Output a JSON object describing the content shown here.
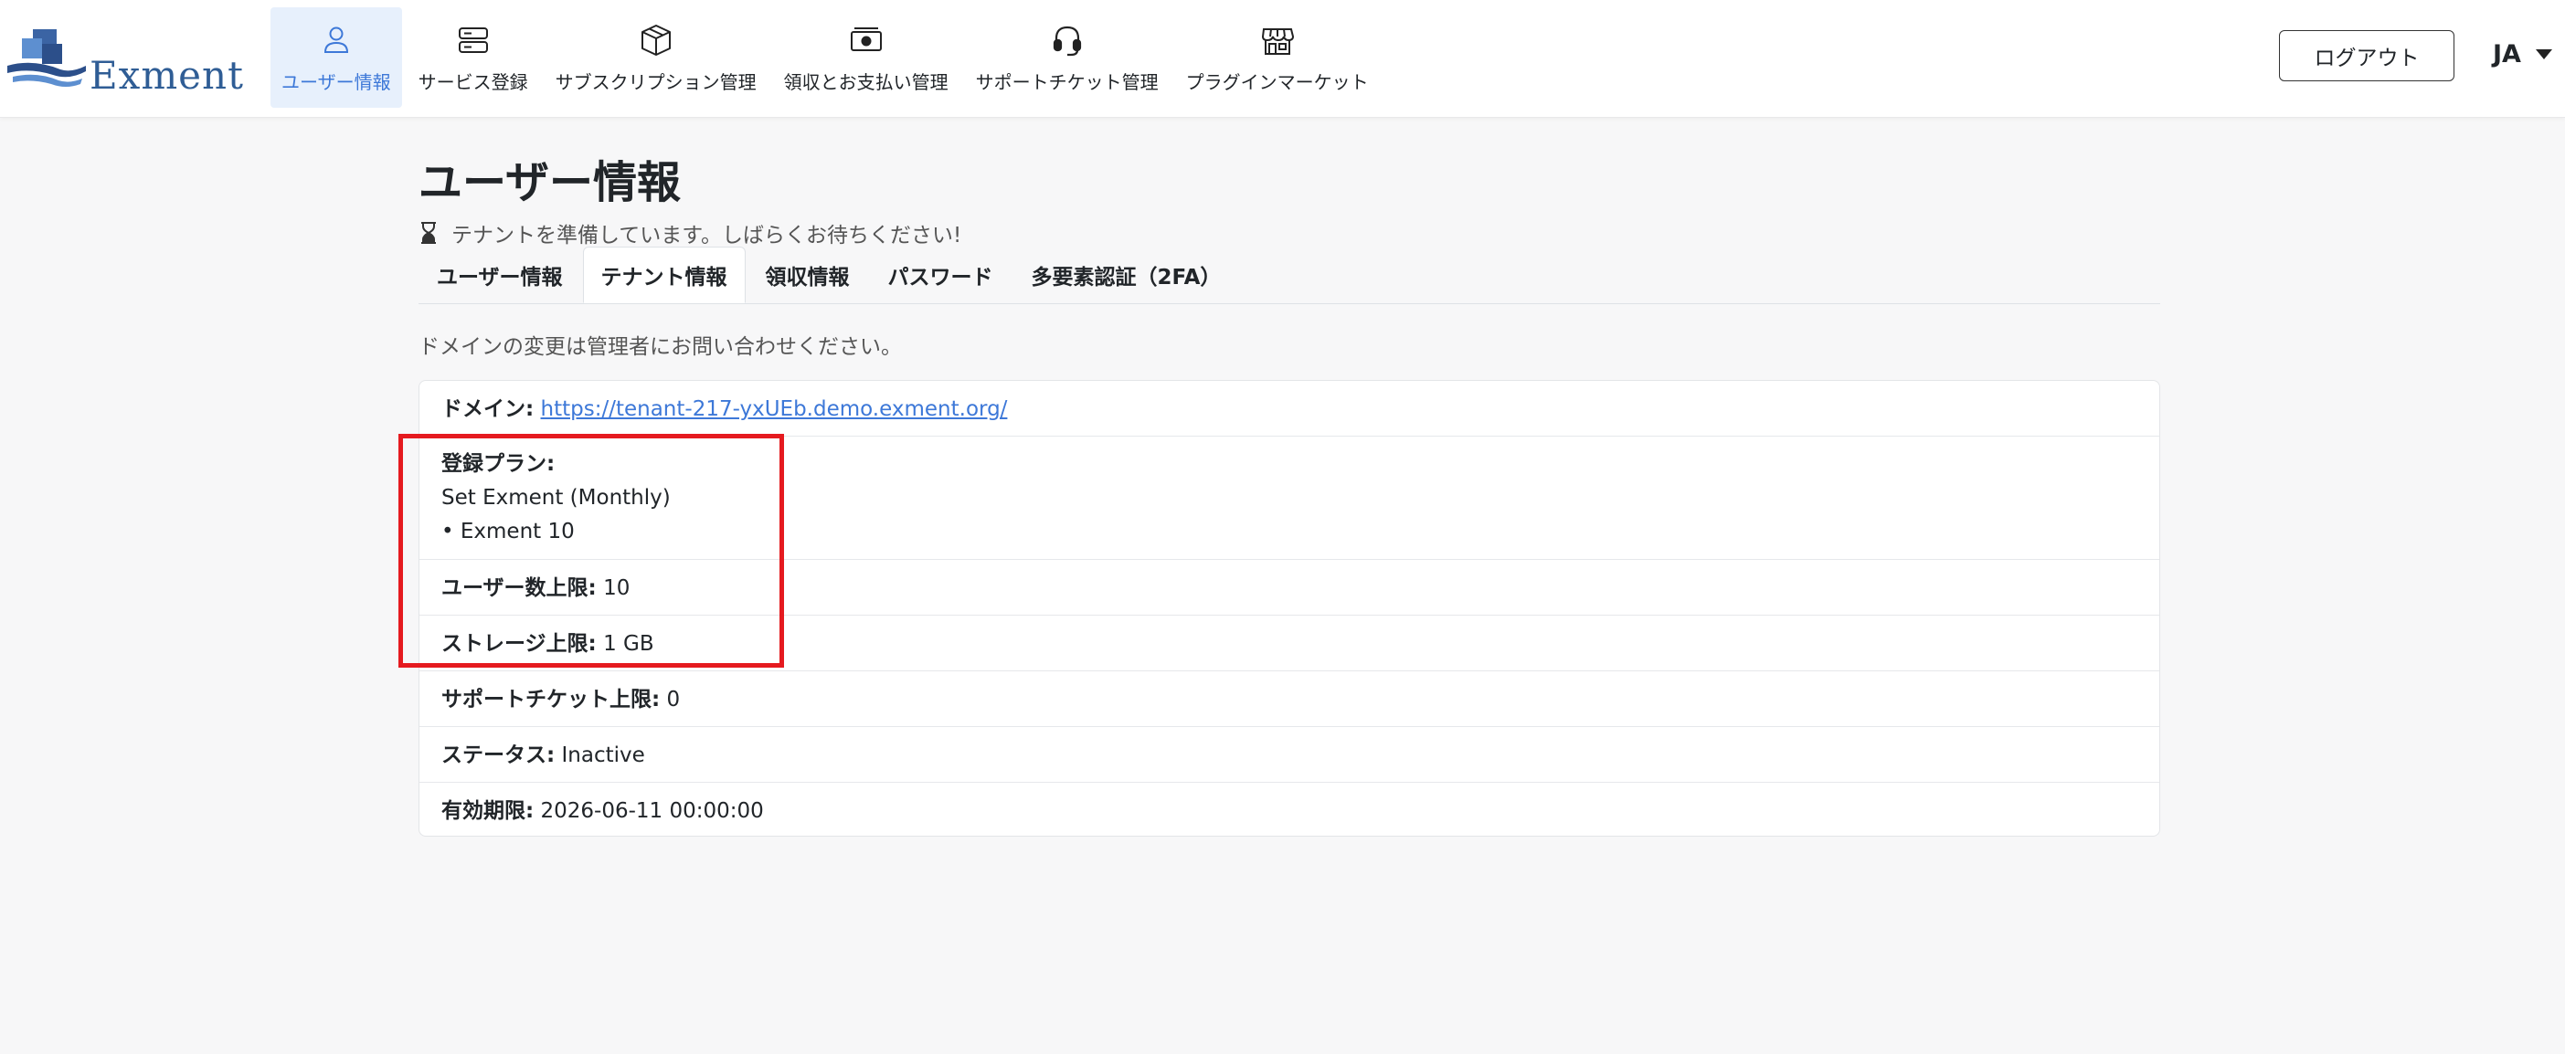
{
  "app": {
    "logo_text": "Exment"
  },
  "nav": {
    "items": [
      {
        "label": "ユーザー情報",
        "icon": "user-icon",
        "active": true
      },
      {
        "label": "サービス登録",
        "icon": "server-icon",
        "active": false
      },
      {
        "label": "サブスクリプション管理",
        "icon": "box-icon",
        "active": false
      },
      {
        "label": "領収とお支払い管理",
        "icon": "cash-icon",
        "active": false
      },
      {
        "label": "サポートチケット管理",
        "icon": "headset-icon",
        "active": false
      },
      {
        "label": "プラグインマーケット",
        "icon": "shop-icon",
        "active": false
      }
    ],
    "logout_label": "ログアウト",
    "language": "JA"
  },
  "page": {
    "title": "ユーザー情報",
    "notice": "テナントを準備しています。しばらくお待ちください!",
    "tabs": [
      {
        "label": "ユーザー情報",
        "active": false
      },
      {
        "label": "テナント情報",
        "active": true
      },
      {
        "label": "領収情報",
        "active": false
      },
      {
        "label": "パスワード",
        "active": false
      },
      {
        "label": "多要素認証（2FA）",
        "active": false
      }
    ],
    "hint": "ドメインの変更は管理者にお問い合わせください。"
  },
  "tenant": {
    "domain_label": "ドメイン:",
    "domain_value": "https://tenant-217-yxUEb.demo.exment.org/",
    "plan_label": "登録プラン:",
    "plan_name": "Set Exment (Monthly)",
    "plan_item": "• Exment 10",
    "user_limit_label": "ユーザー数上限:",
    "user_limit_value": "10",
    "storage_label": "ストレージ上限:",
    "storage_value": "1 GB",
    "ticket_label": "サポートチケット上限:",
    "ticket_value": "0",
    "status_label": "ステータス:",
    "status_value": "Inactive",
    "expiry_label": "有効期限:",
    "expiry_value": "2026-06-11 00:00:00"
  },
  "colors": {
    "accent": "#3d78d8",
    "highlight": "#e51a1f",
    "active_nav_bg": "#e7f0fc"
  }
}
